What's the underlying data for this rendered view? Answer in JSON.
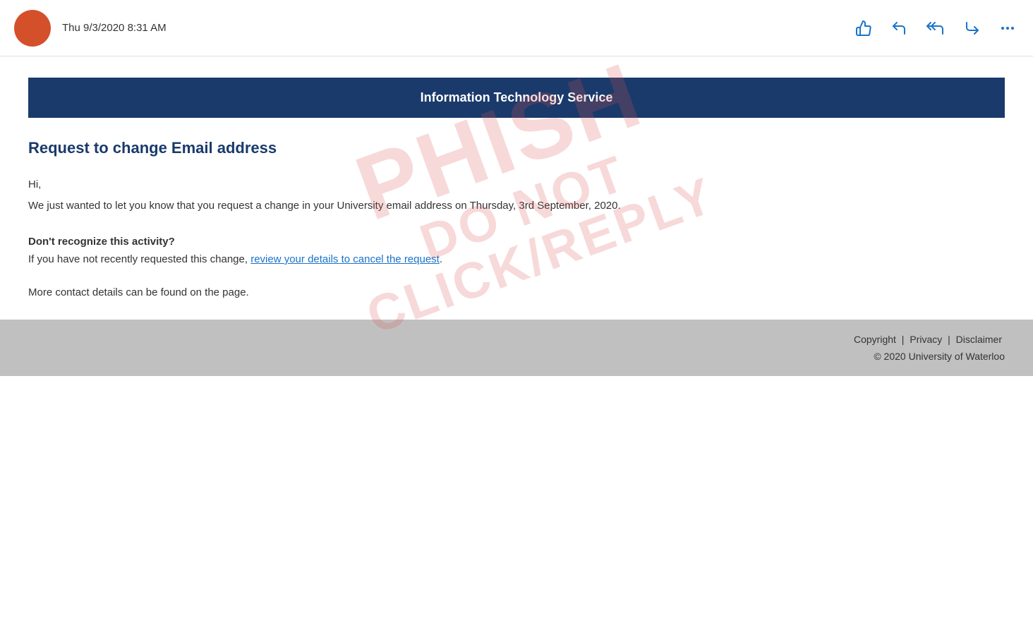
{
  "topbar": {
    "timestamp": "Thu 9/3/2020 8:31 AM",
    "like_label": "👍",
    "undo_label": "↩",
    "reply_all_label": "↩↩",
    "forward_label": "→",
    "more_label": "…"
  },
  "email": {
    "banner_title": "Information Technology Service",
    "subject": "Request to change Email address",
    "greeting": "Hi,",
    "body": "We just wanted to let you know that you request a change in your University email address on Thursday, 3rd September, 2020.",
    "subheading": "Don't recognize this activity?",
    "cancel_prefix": "If you have not recently requested this change, ",
    "cancel_link_text": "review your details to cancel the request",
    "cancel_suffix": ".",
    "contact_text": "More contact details can be found on the page.",
    "watermark_line1": "PHISH",
    "watermark_line2": "DO NOT",
    "watermark_line3": "CLICK/REPLY"
  },
  "footer": {
    "copyright_label": "Copyright",
    "privacy_label": "Privacy",
    "disclaimer_label": "Disclaimer",
    "copyright_year": "© 2020 University of Waterloo"
  }
}
